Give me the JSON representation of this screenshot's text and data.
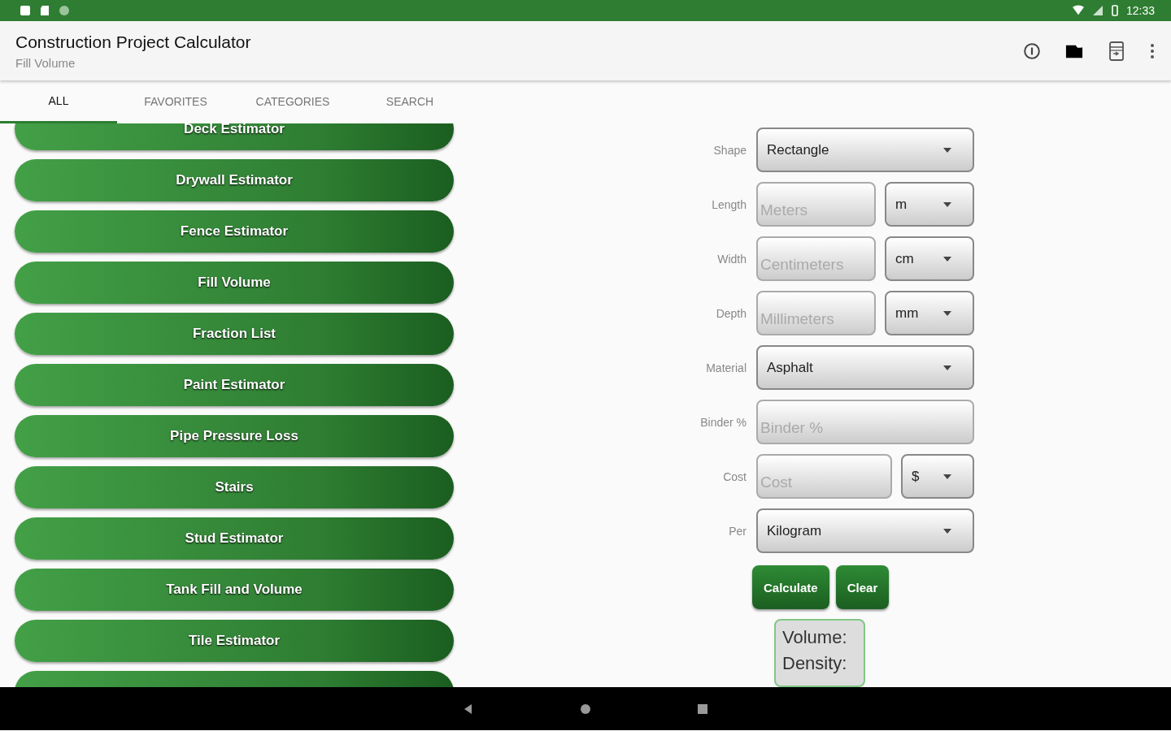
{
  "status_bar": {
    "time": "12:33"
  },
  "app_bar": {
    "title": "Construction Project Calculator",
    "subtitle": "Fill Volume"
  },
  "tabs": [
    {
      "label": "ALL",
      "selected": true
    },
    {
      "label": "FAVORITES",
      "selected": false
    },
    {
      "label": "CATEGORIES",
      "selected": false
    },
    {
      "label": "SEARCH",
      "selected": false
    }
  ],
  "calculators": [
    "Deck Estimator",
    "Drywall Estimator",
    "Fence Estimator",
    "Fill Volume",
    "Fraction List",
    "Paint Estimator",
    "Pipe Pressure Loss",
    "Stairs",
    "Stud Estimator",
    "Tank Fill and Volume",
    "Tile Estimator"
  ],
  "form": [
    {
      "kind": "select",
      "label": "Shape",
      "value": "Rectangle"
    },
    {
      "kind": "input_unit",
      "label": "Length",
      "placeholder": "Meters",
      "unit": "m"
    },
    {
      "kind": "input_unit",
      "label": "Width",
      "placeholder": "Centimeters",
      "unit": "cm"
    },
    {
      "kind": "input_unit",
      "label": "Depth",
      "placeholder": "Millimeters",
      "unit": "mm"
    },
    {
      "kind": "select",
      "label": "Material",
      "value": "Asphalt"
    },
    {
      "kind": "input",
      "label": "Binder %",
      "placeholder": "Binder %"
    },
    {
      "kind": "input_currency",
      "label": "Cost",
      "placeholder": "Cost",
      "unit": "$"
    },
    {
      "kind": "select",
      "label": "Per",
      "value": "Kilogram"
    }
  ],
  "buttons": [
    "Calculate",
    "Clear"
  ],
  "results": [
    "Volume:",
    "Density:"
  ]
}
